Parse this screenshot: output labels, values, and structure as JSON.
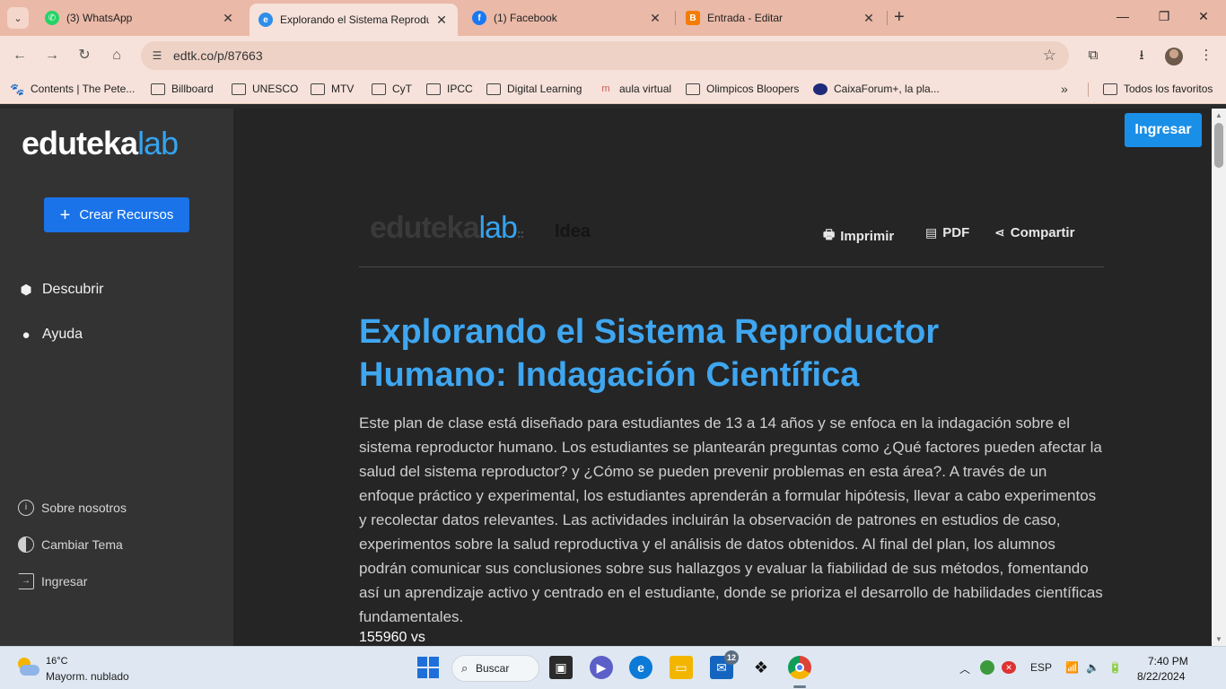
{
  "browser": {
    "tabs": [
      {
        "title": "(3) WhatsApp",
        "icon": "whatsapp-icon",
        "active": false
      },
      {
        "title": "Explorando el Sistema Reproductor",
        "icon": "edutekalab-icon",
        "active": true
      },
      {
        "title": "(1) Facebook",
        "icon": "facebook-icon",
        "active": false
      },
      {
        "title": "Entrada - Editar",
        "icon": "blogger-icon",
        "active": false
      }
    ],
    "url": "edtk.co/p/87663",
    "bookmarks": [
      {
        "label": "Contents | The Pete..."
      },
      {
        "label": "Billboard"
      },
      {
        "label": "UNESCO"
      },
      {
        "label": "MTV"
      },
      {
        "label": "CyT"
      },
      {
        "label": "IPCC"
      },
      {
        "label": "Digital Learning"
      },
      {
        "label": "aula virtual"
      },
      {
        "label": "Olimpicos Bloopers"
      },
      {
        "label": "CaixaForum+, la pla..."
      }
    ],
    "all_bookmarks": "Todos los favoritos"
  },
  "sidebar": {
    "logo_a": "eduteka",
    "logo_b": "lab",
    "create_button": "Crear Recursos",
    "nav": [
      {
        "label": "Descubrir"
      },
      {
        "label": "Ayuda"
      }
    ],
    "footer": [
      {
        "label": "Sobre nosotros"
      },
      {
        "label": "Cambiar Tema"
      },
      {
        "label": "Ingresar"
      }
    ]
  },
  "header": {
    "login_button": "Ingresar",
    "logo_a": "eduteka",
    "logo_b": "lab",
    "section": "Idea",
    "actions": [
      {
        "label": "Imprimir"
      },
      {
        "label": "PDF"
      },
      {
        "label": "Compartir"
      }
    ]
  },
  "article": {
    "title": "Explorando el Sistema Reproductor Humano: Indagación Científica",
    "description": "Este plan de clase está diseñado para estudiantes de 13 a 14 años y se enfoca en la indagación sobre el sistema reproductor humano. Los estudiantes se plantearán preguntas como ¿Qué factores pueden afectar la salud del sistema reproductor? y ¿Cómo se pueden prevenir problemas en esta área?. A través de un enfoque práctico y experimental, los estudiantes aprenderán a formular hipótesis, llevar a cabo experimentos y recolectar datos relevantes. Las actividades incluirán la observación de patrones en estudios de caso, experimentos sobre la salud reproductiva y el análisis de datos obtenidos. Al final del plan, los alumnos podrán comunicar sus conclusiones sobre sus hallazgos y evaluar la fiabilidad de sus métodos, fomentando así un aprendizaje activo y centrado en el estudiante, donde se prioriza el desarrollo de habilidades científicas fundamentales.",
    "stray_text": "155960 vs"
  },
  "taskbar": {
    "weather_temp": "16°C",
    "weather_desc": "Mayorm. nublado",
    "search_label": "Buscar",
    "mail_badge": "12",
    "language": "ESP",
    "time": "7:40 PM",
    "date": "8/22/2024"
  },
  "colors": {
    "accent": "#3fa6f0",
    "primary_button": "#1a73e8",
    "sidebar_bg": "#333333",
    "content_bg": "#252525",
    "chrome_tab": "#eab9a8"
  }
}
